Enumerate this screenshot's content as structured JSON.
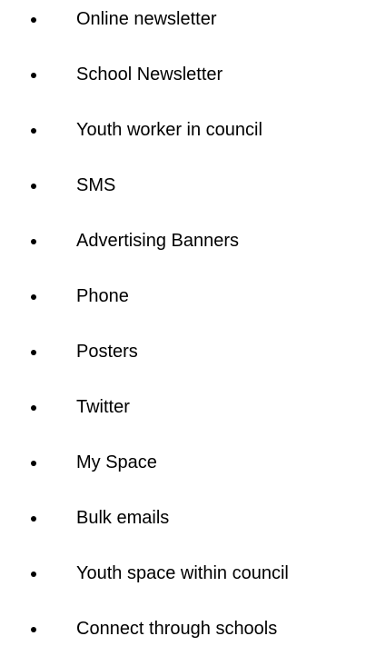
{
  "list": {
    "items": [
      "Online newsletter",
      "School Newsletter",
      "Youth worker in council",
      "SMS",
      "Advertising Banners",
      "Phone",
      "Posters",
      "Twitter",
      "My Space",
      "Bulk emails",
      "Youth space within council",
      "Connect through schools"
    ]
  }
}
